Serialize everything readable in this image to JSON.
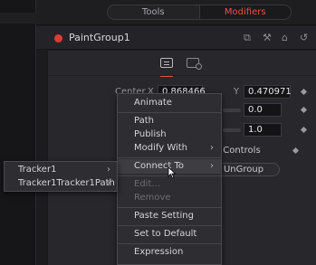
{
  "tabs": {
    "tools": "Tools",
    "modifiers": "Modifiers",
    "active": "Modifiers",
    "accent_color": "#e2534f"
  },
  "node": {
    "title": "PaintGroup1",
    "status_color": "#e03a36",
    "header_icons": [
      "versions-icon",
      "pin-icon",
      "lock-icon",
      "reset-icon"
    ]
  },
  "inspector": {
    "icon_tabs": [
      "controls-tab-icon",
      "modifiers-tab-icon"
    ],
    "center_label": "Center",
    "x_label": "X",
    "x_value": "0.868466",
    "y_label": "Y",
    "y_value": "0.470971",
    "field2_value": "0.0",
    "field3_value": "1.0",
    "controls_label": "o Controls",
    "ungroup_label": "UnGroup"
  },
  "context_menu": {
    "items": [
      {
        "label": "Animate"
      },
      {
        "label": "Path"
      },
      {
        "label": "Publish"
      },
      {
        "label": "Modify With"
      },
      {
        "label": "Connect To"
      },
      {
        "label": "Edit..."
      },
      {
        "label": "Remove"
      },
      {
        "label": "Paste Setting"
      },
      {
        "label": "Set to Default"
      },
      {
        "label": "Expression"
      }
    ],
    "highlighted": "Connect To"
  },
  "submenu": {
    "items": [
      {
        "label": "Tracker1"
      },
      {
        "label": "Tracker1Tracker1Path"
      }
    ]
  }
}
